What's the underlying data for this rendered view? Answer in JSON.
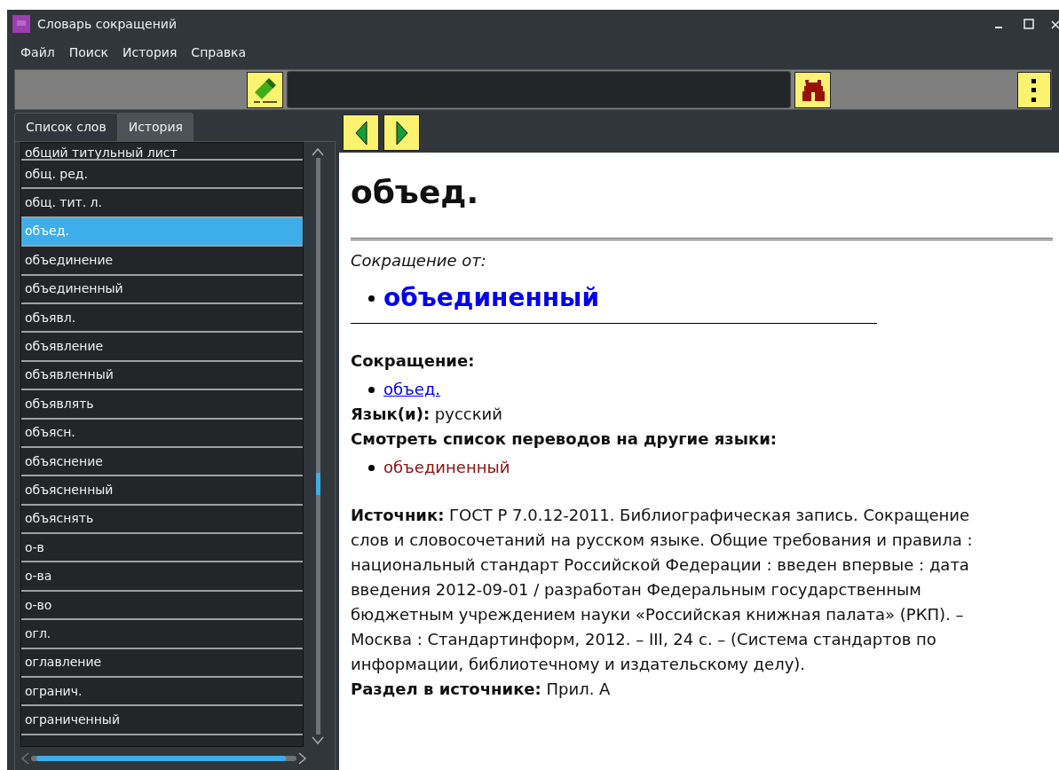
{
  "window": {
    "title": "Словарь сокращений"
  },
  "menu": [
    "Файл",
    "Поиск",
    "История",
    "Справка"
  ],
  "tabs": [
    {
      "label": "Список слов",
      "selected": true
    },
    {
      "label": "История",
      "selected": false
    }
  ],
  "word_list": [
    {
      "text": "общий титульный лист",
      "selected": false
    },
    {
      "text": "общ. ред.",
      "selected": false
    },
    {
      "text": "общ. тит. л.",
      "selected": false
    },
    {
      "text": "объед.",
      "selected": true
    },
    {
      "text": "объединение",
      "selected": false
    },
    {
      "text": "объединенный",
      "selected": false
    },
    {
      "text": "объявл.",
      "selected": false
    },
    {
      "text": "объявление",
      "selected": false
    },
    {
      "text": "объявленный",
      "selected": false
    },
    {
      "text": "объявлять",
      "selected": false
    },
    {
      "text": "объясн.",
      "selected": false
    },
    {
      "text": "объяснение",
      "selected": false
    },
    {
      "text": "объясненный",
      "selected": false
    },
    {
      "text": "объяснять",
      "selected": false
    },
    {
      "text": "о-в",
      "selected": false
    },
    {
      "text": "о-ва",
      "selected": false
    },
    {
      "text": "о-во",
      "selected": false
    },
    {
      "text": "огл.",
      "selected": false
    },
    {
      "text": "оглавление",
      "selected": false
    },
    {
      "text": "огранич.",
      "selected": false
    },
    {
      "text": "ограниченный",
      "selected": false
    }
  ],
  "article": {
    "headword": "объед.",
    "from_label": "Сокращение от:",
    "expansion": "объединенный",
    "abbr_label": "Сокращение:",
    "abbr_link": "объед.",
    "language": "**Язык(и):** русский",
    "translations_label": "Смотреть список переводов на другие языки:",
    "translation_link": "объединенный",
    "source": "**Источник:** ГОСТ Р 7.0.12-2011. Библиографическая запись. Сокращение слов и словосочетаний на русском языке. Общие требования и правила : национальный стандарт Российской Федерации : введен впервые : дата введения 2012-09-01 / разработан Федеральным государственным бюджетным учреждением науки «Российская книжная палата» (РКП). – Москва : Стандартинформ, 2012. – III, 24 с. – (Система стандартов по информации, библиотечному и издательскому делу).",
    "section": "**Раздел в источнике:** Прил. А"
  }
}
